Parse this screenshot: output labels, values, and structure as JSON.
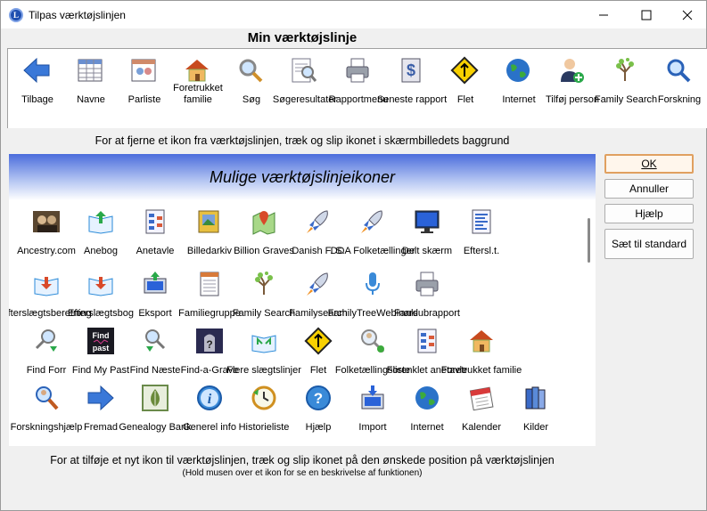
{
  "window": {
    "title": "Tilpas værktøjslinjen",
    "app_icon_letter": "L"
  },
  "toolbar": {
    "heading": "Min værktøjslinje",
    "items": [
      {
        "label": "Tilbage",
        "icon": "back-arrow-icon"
      },
      {
        "label": "Navne",
        "icon": "names-grid-icon"
      },
      {
        "label": "Parliste",
        "icon": "couples-list-icon"
      },
      {
        "label": "Foretrukket familie",
        "icon": "house-icon"
      },
      {
        "label": "Søg",
        "icon": "magnifier-icon"
      },
      {
        "label": "Søgeresultater",
        "icon": "search-results-icon"
      },
      {
        "label": "Rapportmenu",
        "icon": "printer-icon"
      },
      {
        "label": "Seneste rapport",
        "icon": "latest-report-icon"
      },
      {
        "label": "Flet",
        "icon": "merge-sign-icon"
      },
      {
        "label": "Internet",
        "icon": "globe-icon"
      },
      {
        "label": "Tilføj person",
        "icon": "add-person-icon"
      },
      {
        "label": "Family Search",
        "icon": "family-tree-icon"
      },
      {
        "label": "Forskning",
        "icon": "research-icon"
      }
    ]
  },
  "hints": {
    "remove": "For at fjerne et ikon fra værktøjslinjen, træk og slip ikonet i skærmbilledets baggrund",
    "add": "For at tilføje et nyt ikon til værktøjslinjen, træk og slip ikonet på den ønskede position på værktøjslinjen",
    "add_sub": "(Hold musen over et ikon for se en beskrivelse af funktionen)"
  },
  "panel": {
    "heading": "Mulige værktøjslinjeikoner",
    "rows": [
      [
        {
          "label": "Ancestry.com",
          "icon": "ancestry-photo-icon"
        },
        {
          "label": "Anebog",
          "icon": "upload-book-icon"
        },
        {
          "label": "Anetavle",
          "icon": "pedigree-icon"
        },
        {
          "label": "Billedarkiv",
          "icon": "photo-album-icon"
        },
        {
          "label": "Billion Graves",
          "icon": "map-pin-icon"
        },
        {
          "label": "Danish F. S.",
          "icon": "rocket-icon"
        },
        {
          "label": "DDA Folketællinger",
          "icon": "rocket-icon"
        },
        {
          "label": "Delt skærm",
          "icon": "monitor-icon"
        },
        {
          "label": "Eftersl.t.",
          "icon": "descendant-chart-icon"
        }
      ],
      [
        {
          "label": "Efterslægtsberetning",
          "icon": "download-book-icon"
        },
        {
          "label": "Efterslægtsbog",
          "icon": "download-book-icon"
        },
        {
          "label": "Eksport",
          "icon": "export-computer-icon"
        },
        {
          "label": "Familiegruppe",
          "icon": "family-sheet-icon"
        },
        {
          "label": "Family Search",
          "icon": "family-tree-icon"
        },
        {
          "label": "Familysearch",
          "icon": "rocket-icon"
        },
        {
          "label": "FamilyTreeWebinars",
          "icon": "microphone-icon"
        },
        {
          "label": "Fanklubrapport",
          "icon": "printer-icon"
        }
      ],
      [
        {
          "label": "Find Forr",
          "icon": "find-search-icon"
        },
        {
          "label": "Find My Past",
          "icon": "findmypast-logo-icon"
        },
        {
          "label": "Find Næste",
          "icon": "find-next-icon"
        },
        {
          "label": "Find-a-Grave",
          "icon": "grave-icon"
        },
        {
          "label": "Flere slægtslinjer",
          "icon": "multi-lines-icon"
        },
        {
          "label": "Flet",
          "icon": "merge-sign-icon"
        },
        {
          "label": "Folketællingsliste",
          "icon": "census-search-icon"
        },
        {
          "label": "Forenklet anetavle",
          "icon": "pedigree-icon"
        },
        {
          "label": "Foretrukket familie",
          "icon": "house-icon"
        }
      ],
      [
        {
          "label": "Forskningshjælp",
          "icon": "research-help-icon"
        },
        {
          "label": "Fremad",
          "icon": "forward-arrow-icon"
        },
        {
          "label": "Genealogy Bank",
          "icon": "leaf-icon"
        },
        {
          "label": "Generel info",
          "icon": "info-icon"
        },
        {
          "label": "Historieliste",
          "icon": "history-clock-icon"
        },
        {
          "label": "Hjælp",
          "icon": "help-icon"
        },
        {
          "label": "Import",
          "icon": "import-computer-icon"
        },
        {
          "label": "Internet",
          "icon": "globe-icon"
        },
        {
          "label": "Kalender",
          "icon": "calendar-icon"
        },
        {
          "label": "Kilder",
          "icon": "books-icon"
        }
      ]
    ]
  },
  "buttons": {
    "ok": "OK",
    "cancel": "Annuller",
    "help": "Hjælp",
    "reset": "Sæt til standard"
  }
}
